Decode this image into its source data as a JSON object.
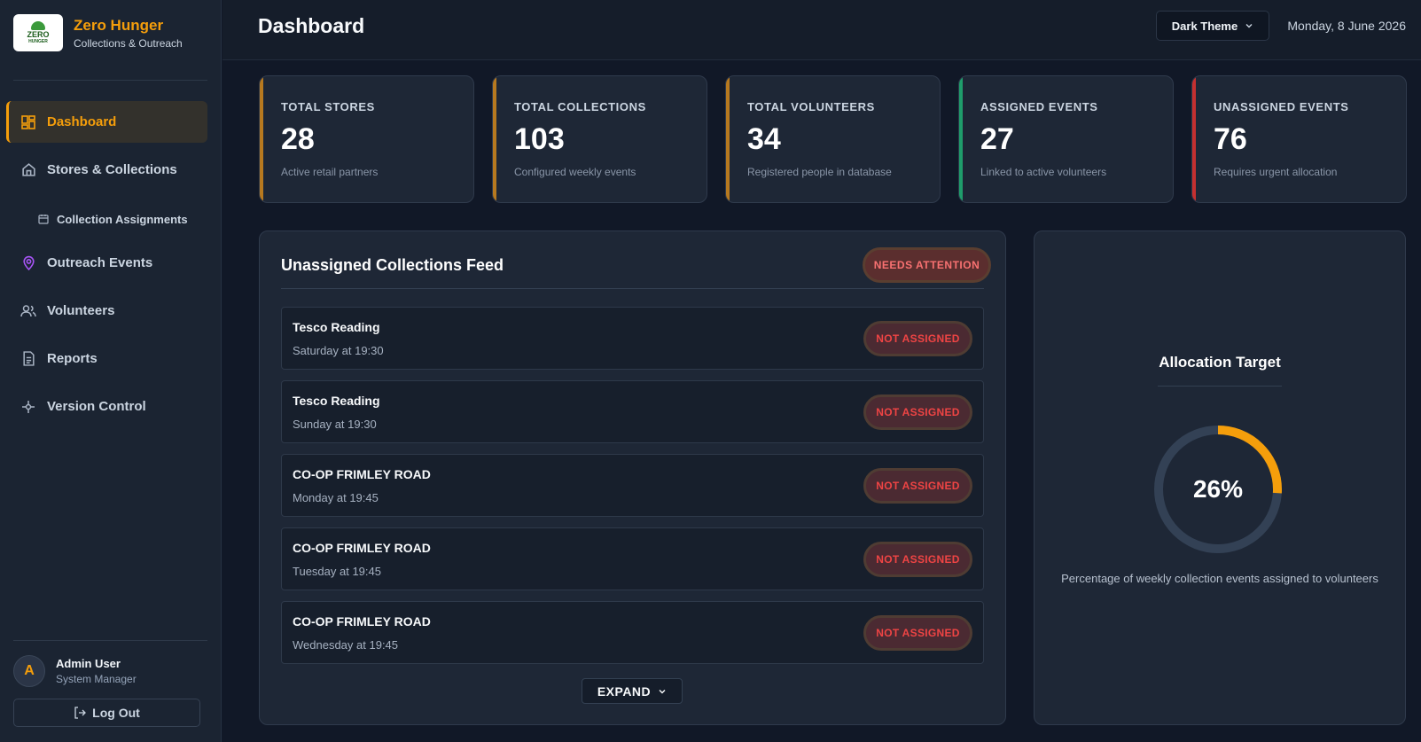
{
  "brand": {
    "name": "Zero Hunger",
    "subtitle": "Collections & Outreach",
    "logo_line1": "ZERO",
    "logo_line2": "HUNGER"
  },
  "sidebar": {
    "items": [
      {
        "label": "Dashboard",
        "icon": "grid-icon",
        "active": true
      },
      {
        "label": "Stores & Collections",
        "icon": "home-icon"
      },
      {
        "label": "Collection Assignments",
        "icon": "calendar-icon",
        "sub": true
      },
      {
        "label": "Outreach Events",
        "icon": "map-pin-icon"
      },
      {
        "label": "Volunteers",
        "icon": "users-icon"
      },
      {
        "label": "Reports",
        "icon": "file-icon"
      },
      {
        "label": "Version Control",
        "icon": "git-commit-icon"
      }
    ]
  },
  "user": {
    "initial": "A",
    "name": "Admin User",
    "role": "System Manager",
    "logout_label": "Log Out"
  },
  "header": {
    "title": "Dashboard",
    "theme": "Dark Theme",
    "date": "Monday, 8 June 2026"
  },
  "stats": [
    {
      "label": "TOTAL STORES",
      "value": "28",
      "desc": "Active retail partners",
      "accent": "#b7791f"
    },
    {
      "label": "TOTAL COLLECTIONS",
      "value": "103",
      "desc": "Configured weekly events",
      "accent": "#b7791f"
    },
    {
      "label": "TOTAL VOLUNTEERS",
      "value": "34",
      "desc": "Registered people in database",
      "accent": "#b7791f"
    },
    {
      "label": "ASSIGNED EVENTS",
      "value": "27",
      "desc": "Linked to active volunteers",
      "accent": "#1f9d6b"
    },
    {
      "label": "UNASSIGNED EVENTS",
      "value": "76",
      "desc": "Requires urgent allocation",
      "accent": "#c53030"
    }
  ],
  "feed": {
    "title": "Unassigned Collections Feed",
    "badge": "NEEDS ATTENTION",
    "rows": [
      {
        "name": "Tesco Reading",
        "time": "Saturday at 19:30",
        "status": "NOT ASSIGNED"
      },
      {
        "name": "Tesco Reading",
        "time": "Sunday at 19:30",
        "status": "NOT ASSIGNED"
      },
      {
        "name": "CO-OP FRIMLEY ROAD",
        "time": "Monday at 19:45",
        "status": "NOT ASSIGNED"
      },
      {
        "name": "CO-OP FRIMLEY ROAD",
        "time": "Tuesday at 19:45",
        "status": "NOT ASSIGNED"
      },
      {
        "name": "CO-OP FRIMLEY ROAD",
        "time": "Wednesday at 19:45",
        "status": "NOT ASSIGNED"
      }
    ],
    "expand_label": "EXPAND"
  },
  "allocation": {
    "title": "Allocation Target",
    "percent": 26,
    "percent_label": "26%",
    "caption": "Percentage of weekly collection events assigned to volunteers",
    "color": "#f59e0b",
    "track_color": "#334155"
  }
}
